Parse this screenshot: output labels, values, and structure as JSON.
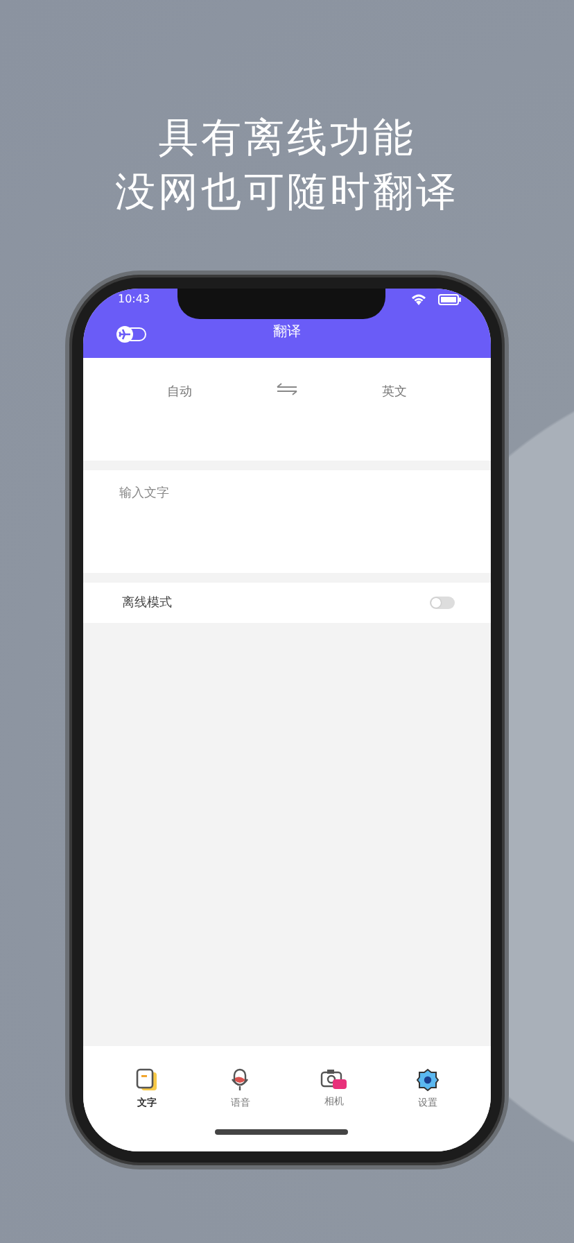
{
  "headline": [
    "具有离线功能",
    "没网也可随时翻译"
  ],
  "status_bar": {
    "time": "10:43"
  },
  "nav": {
    "title": "翻译"
  },
  "languages": {
    "source": "自动",
    "target": "英文"
  },
  "input": {
    "placeholder": "输入文字"
  },
  "offline_mode": {
    "label": "离线模式",
    "on": false
  },
  "tabs": [
    {
      "kind": "text",
      "label": "文字",
      "selected": true
    },
    {
      "kind": "voice",
      "label": "语音",
      "selected": false
    },
    {
      "kind": "camera",
      "label": "相机",
      "selected": false
    },
    {
      "kind": "settings",
      "label": "设置",
      "selected": false
    }
  ]
}
